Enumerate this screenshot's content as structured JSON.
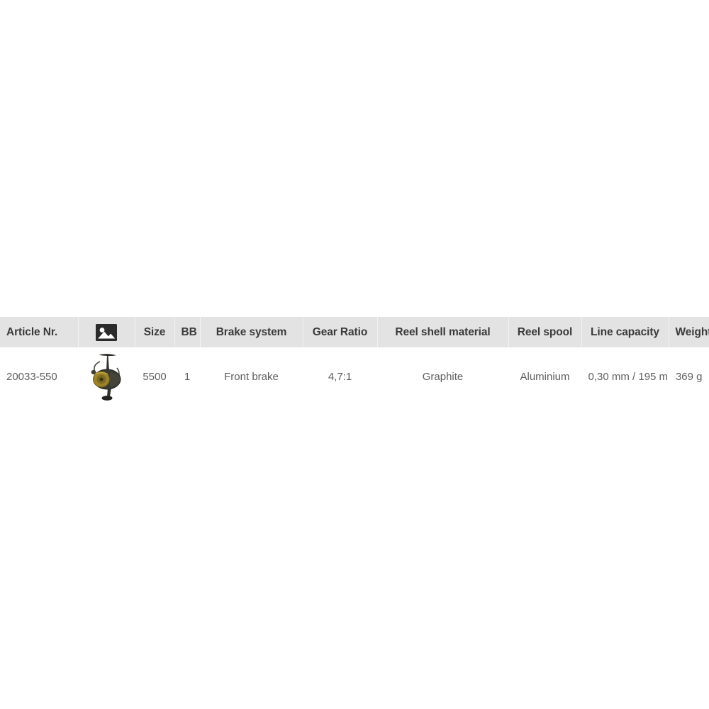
{
  "table": {
    "name": "product-specification-table",
    "columns": [
      {
        "key": "article",
        "label": "Article Nr.",
        "icon": null
      },
      {
        "key": "thumb",
        "label": "",
        "icon": "image-placeholder-icon"
      },
      {
        "key": "size",
        "label": "Size",
        "icon": null
      },
      {
        "key": "bb",
        "label": "BB",
        "icon": null
      },
      {
        "key": "brake",
        "label": "Brake system",
        "icon": null
      },
      {
        "key": "gear",
        "label": "Gear Ratio",
        "icon": null
      },
      {
        "key": "shell",
        "label": "Reel shell material",
        "icon": null
      },
      {
        "key": "spool",
        "label": "Reel spool",
        "icon": null
      },
      {
        "key": "linecap",
        "label": "Line capacity",
        "icon": null
      },
      {
        "key": "weight",
        "label": "Weight",
        "icon": null
      }
    ],
    "rows": [
      {
        "article": "20033-550",
        "thumb_alt": "fishing-reel-thumbnail",
        "size": "5500",
        "bb": "1",
        "brake": "Front brake",
        "gear": "4,7:1",
        "shell": "Graphite",
        "spool": "Aluminium",
        "linecap": "0,30 mm / 195 m",
        "weight": "369 g"
      }
    ]
  },
  "colors": {
    "header_background": "#e3e3e3",
    "header_text": "#3a3a3a",
    "row_background": "#ffffff",
    "row_text": "#5e5e5e",
    "page_background": "#ffffff",
    "divider": "#f2f2f2",
    "icon_dark": "#2b2b2b",
    "reel_body": "#3a3a32",
    "reel_spool_gold": "#9c8326"
  }
}
